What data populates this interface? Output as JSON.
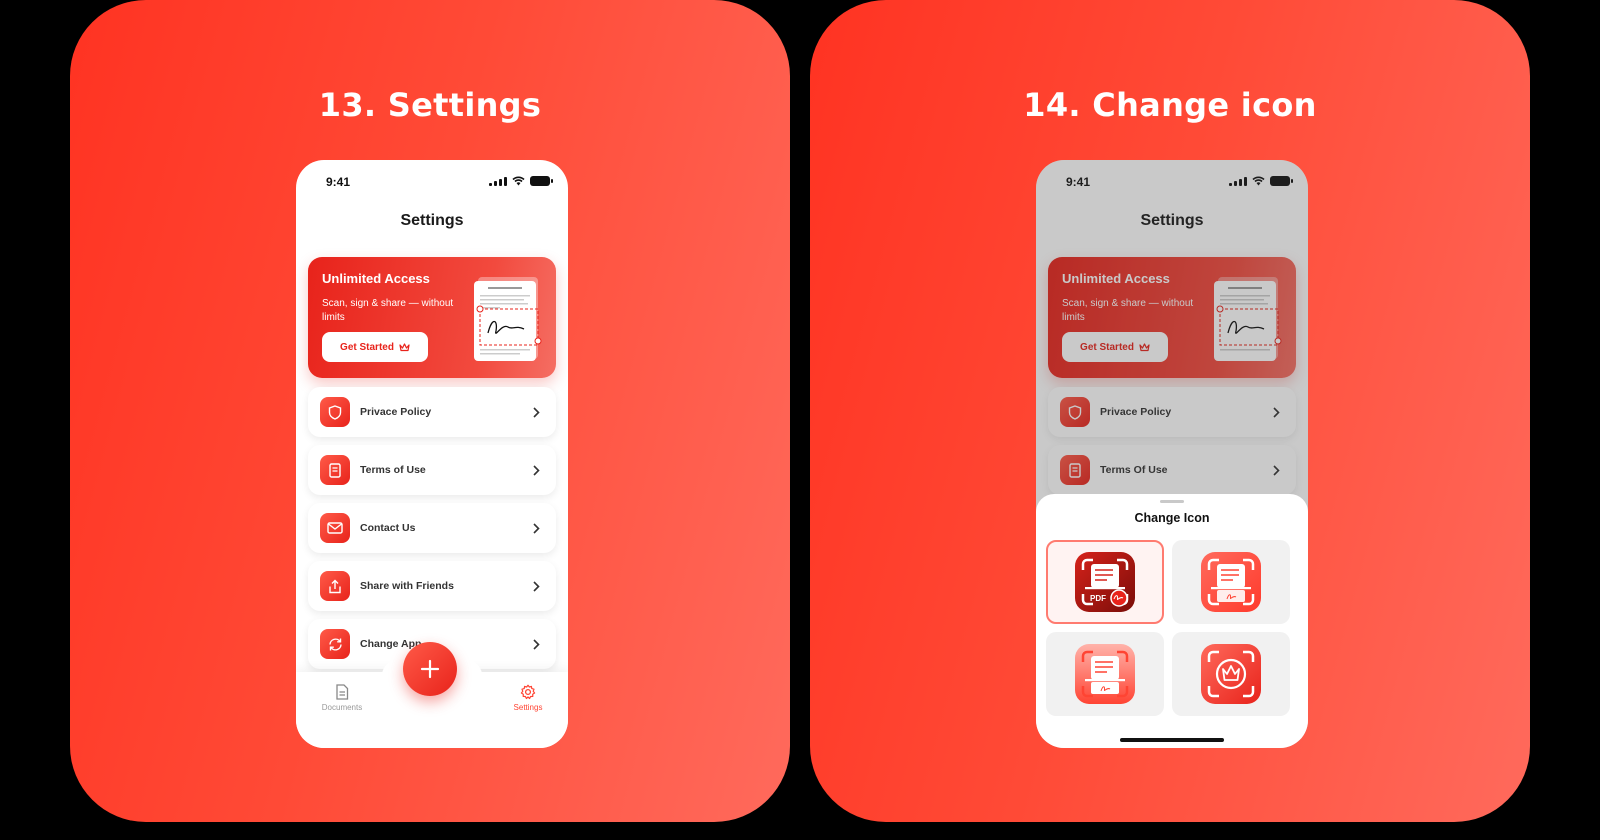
{
  "panels": [
    {
      "title": "13. Settings",
      "status_time": "9:41",
      "screen_title": "Settings",
      "promo": {
        "title": "Unlimited Access",
        "subtitle": "Scan, sign & share — without limits",
        "button": "Get Started"
      },
      "menu": [
        {
          "label": "Privace Policy",
          "icon": "shield-icon"
        },
        {
          "label": "Terms of Use",
          "icon": "document-icon"
        },
        {
          "label": "Contact Us",
          "icon": "mail-icon"
        },
        {
          "label": "Share with Friends",
          "icon": "share-icon"
        },
        {
          "label": "Change App",
          "icon": "refresh-icon"
        }
      ],
      "tabs": {
        "documents": "Documents",
        "settings": "Settings"
      }
    },
    {
      "title": "14. Change icon",
      "status_time": "9:41",
      "screen_title": "Settings",
      "promo": {
        "title": "Unlimited Access",
        "subtitle": "Scan, sign & share — without limits",
        "button": "Get Started"
      },
      "menu": [
        {
          "label": "Privace Policy",
          "icon": "shield-icon"
        },
        {
          "label": "Terms Of Use",
          "icon": "document-icon"
        }
      ],
      "sheet": {
        "title": "Change Icon",
        "options": [
          {
            "name": "dark-red-pdf",
            "badge": "PDF",
            "selected": true
          },
          {
            "name": "light-red-scan",
            "selected": false
          },
          {
            "name": "gradient-scan",
            "selected": false
          },
          {
            "name": "crown",
            "selected": false
          }
        ]
      }
    }
  ],
  "colors": {
    "accent": "#ff4433",
    "accent_dark": "#e8231b",
    "panel_bg": "#ff4a36"
  }
}
